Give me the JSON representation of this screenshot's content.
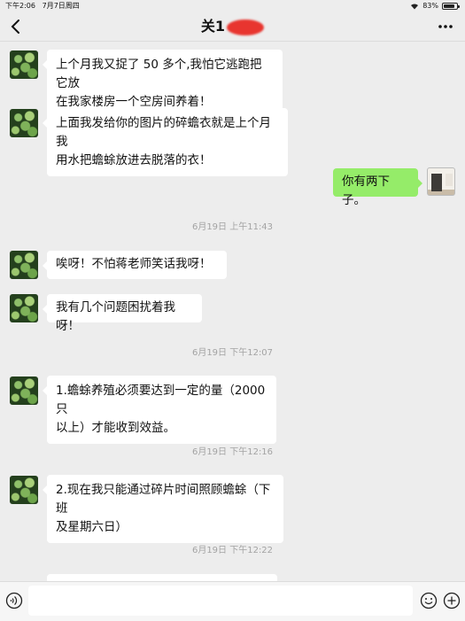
{
  "status_bar": {
    "time": "下午2:06",
    "date": "7月7日周四",
    "battery": "83%",
    "battery_level": 0.83
  },
  "header": {
    "title_visible": "关1",
    "back_icon": "chevron-left-icon",
    "more_icon": "more-dots-icon"
  },
  "messages": [
    {
      "side": "in",
      "text_lines": [
        "上个月我又捉了 50 多个,我怕它逃跑把它放",
        "在我家楼房一个空房间养着！"
      ]
    },
    {
      "side": "in",
      "text_lines": [
        "上面我发给你的图片的碎蟾衣就是上个月我",
        "用水把蟾蜍放进去脱落的衣！"
      ]
    },
    {
      "side": "out",
      "text_lines": [
        "你有两下子。"
      ]
    },
    {
      "side": "in",
      "text_lines": [
        "唉呀！不怕蒋老师笑话我呀！"
      ]
    },
    {
      "side": "in",
      "text_lines": [
        "我有几个问题困扰着我呀！"
      ]
    },
    {
      "side": "in",
      "text_lines": [
        "1.蟾蜍养殖必须要达到一定的量（2000 只",
        "以上）才能收到效益。"
      ]
    },
    {
      "side": "in",
      "text_lines": [
        "2.现在我只能通过碎片时间照顾蟾蜍（下班",
        "及星期六日）"
      ]
    }
  ],
  "timestamps": [
    "6月19日 上午11:43",
    "6月19日 下午12:07",
    "6月19日 下午12:16",
    "6月19日 下午12:22"
  ],
  "input_bar": {
    "voice_icon": "voice-icon",
    "emoji_icon": "emoji-icon",
    "plus_icon": "plus-icon",
    "placeholder": ""
  }
}
